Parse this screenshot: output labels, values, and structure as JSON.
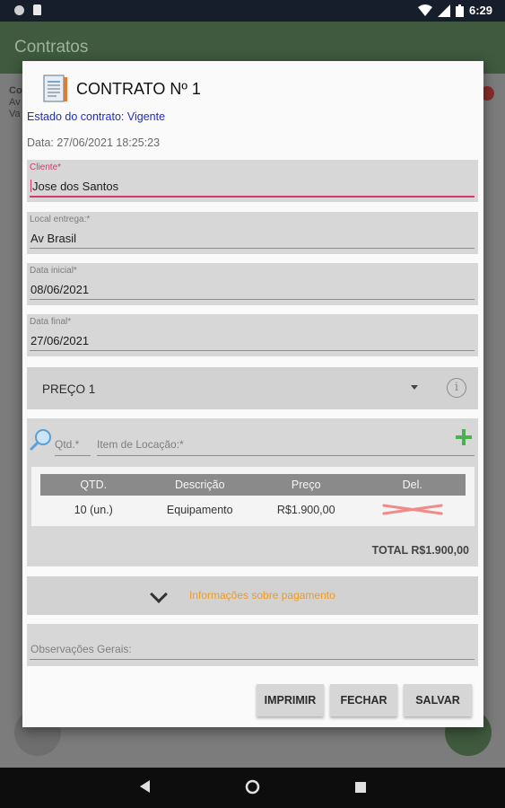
{
  "status_bar": {
    "time": "6:29"
  },
  "background": {
    "app_title": "Contratos",
    "list_preview": [
      "Co",
      "Av",
      "Va"
    ]
  },
  "dialog": {
    "title": "CONTRATO Nº 1",
    "estado": "Estado do contrato: Vigente",
    "data": "Data: 27/06/2021 18:25:23",
    "fields": {
      "cliente": {
        "label": "Cliente*",
        "value": "Jose dos Santos"
      },
      "local_entrega": {
        "label": "Local entrega:*",
        "value": "Av Brasil"
      },
      "data_inicial": {
        "label": "Data inicial*",
        "value": "08/06/2021"
      },
      "data_final": {
        "label": "Data final*",
        "value": "27/06/2021"
      }
    },
    "preco_select": {
      "value": "PREÇO 1"
    },
    "items": {
      "qtd_placeholder": "Qtd.*",
      "item_placeholder": "Item de Locação:*",
      "headers": [
        "QTD.",
        "Descrição",
        "Preço",
        "Del."
      ],
      "rows": [
        {
          "qtd": "10 (un.)",
          "descricao": "Equipamento",
          "preco": "R$1.900,00"
        }
      ],
      "total": "TOTAL R$1.900,00"
    },
    "pagamento": "Informações sobre pagamento",
    "observacoes_placeholder": "Observações Gerais:",
    "buttons": {
      "imprimir": "IMPRIMIR",
      "fechar": "FECHAR",
      "salvar": "SALVAR"
    }
  }
}
